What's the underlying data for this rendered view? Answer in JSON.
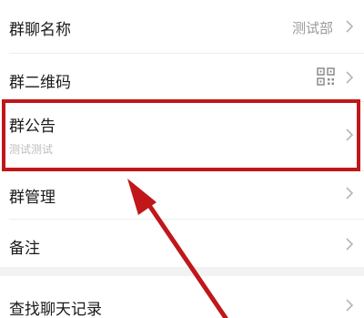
{
  "settings": {
    "group_name": {
      "label": "群聊名称",
      "value": "测试部"
    },
    "qr_code": {
      "label": "群二维码"
    },
    "announcement": {
      "label": "群公告",
      "preview": "测试测试"
    },
    "manage": {
      "label": "群管理"
    },
    "remark": {
      "label": "备注"
    },
    "search_history": {
      "label": "查找聊天记录"
    }
  },
  "annotation": {
    "highlight_color": "#c0171a",
    "arrow_color": "#c0171a"
  },
  "icons": {
    "chevron": "chevron-right-icon",
    "qr": "qr-code-icon"
  }
}
